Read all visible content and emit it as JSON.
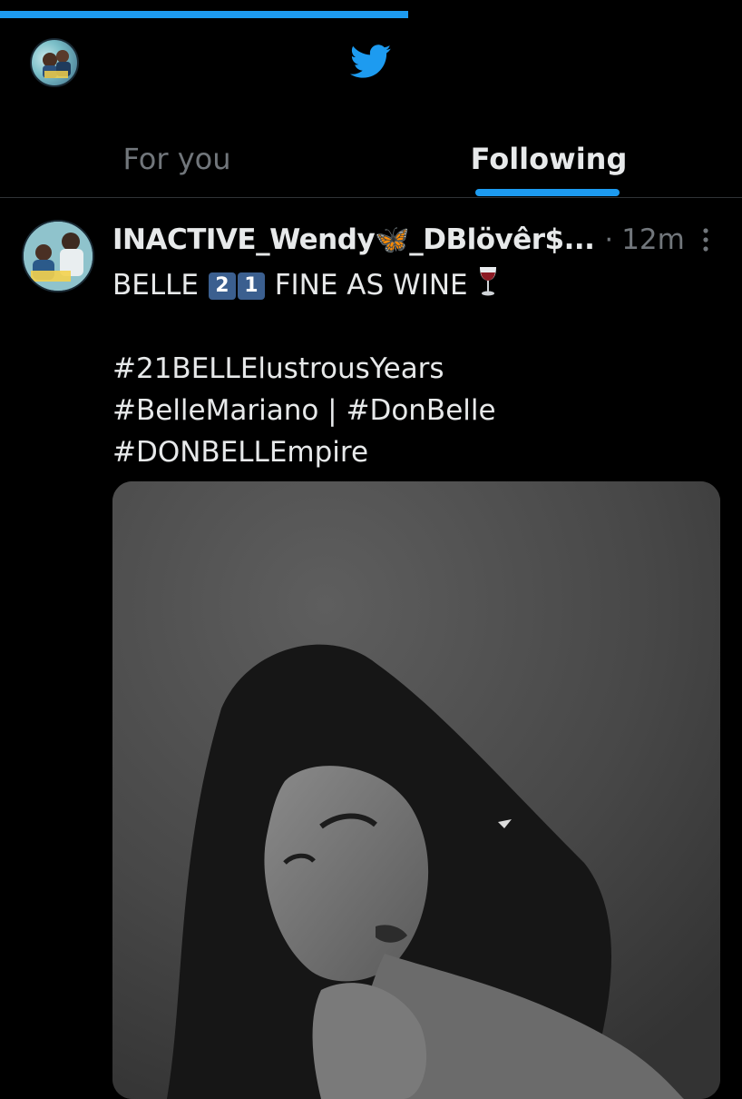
{
  "loading": {
    "progress": 0.55
  },
  "header": {
    "avatar_icon": "profile-avatar",
    "logo_icon": "twitter-bird-icon",
    "accent": "#1d9bf0"
  },
  "tabs": [
    {
      "label": "For you",
      "selected": false
    },
    {
      "label": "Following",
      "selected": true
    }
  ],
  "post": {
    "display_name": "INACTIVE_Wendy🦋_DBlövêr$...",
    "separator": "·",
    "timestamp": "12m",
    "line1_prefix": "BELLE",
    "keycap_1": "2",
    "keycap_2": "1",
    "line1_suffix": "FINE AS WINE",
    "emoji_icon": "wine-glass-icon",
    "hashtag_1": "#21BELLElustrousYears",
    "hashtag_2": "#BelleMariano | #DonBelle",
    "hashtag_3": "#DONBELLEmpire",
    "media_alt": "black-and-white portrait photo"
  }
}
